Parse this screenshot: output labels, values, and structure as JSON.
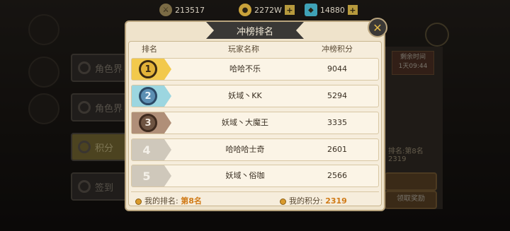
{
  "topbar": {
    "power": "213517",
    "gold": "2272W",
    "gems": "14880"
  },
  "dialog": {
    "title": "冲榜排名",
    "headers": {
      "rank": "排名",
      "name": "玩家名称",
      "score": "冲榜积分"
    },
    "rows": [
      {
        "rank": "1",
        "name": "哈哈不乐",
        "score": "9044",
        "badge_color": "#f2c94c",
        "medal_color": "#3b2a12"
      },
      {
        "rank": "2",
        "name": "妖域丶KK",
        "score": "5294",
        "badge_color": "#9cd6e0",
        "medal_color": "#2c4a66"
      },
      {
        "rank": "3",
        "name": "妖域丶大魔王",
        "score": "3335",
        "badge_color": "#b08f78",
        "medal_color": "#3e2a1e"
      },
      {
        "rank": "4",
        "name": "哈哈哈士奇",
        "score": "2601",
        "badge_color": "#cfc8bb",
        "medal_color": ""
      },
      {
        "rank": "5",
        "name": "妖域丶俗咖",
        "score": "2566",
        "badge_color": "#cfc8bb",
        "medal_color": ""
      }
    ],
    "footer": {
      "my_rank_label": "我的排名:",
      "my_rank_value": "第8名",
      "my_score_label": "我的积分:",
      "my_score_value": "2319"
    }
  },
  "background": {
    "menu": [
      "角色界",
      "角色界",
      "积分",
      "签到"
    ],
    "time_label": "剩余时间",
    "time_value": "1天09:44",
    "rank_label": "排名:",
    "rank_value": "第8名",
    "score_value": "2319",
    "claim_btn": "领取奖励"
  }
}
